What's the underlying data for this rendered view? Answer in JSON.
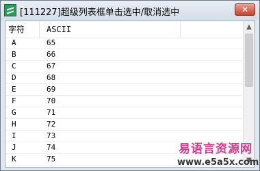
{
  "window": {
    "title": "[111227]超级列表框单击选中/取消选中",
    "close_glyph": "✕"
  },
  "list": {
    "columns": [
      "字符",
      "ASCII"
    ],
    "rows": [
      {
        "char": "A",
        "ascii": "65"
      },
      {
        "char": "B",
        "ascii": "66"
      },
      {
        "char": "C",
        "ascii": "67"
      },
      {
        "char": "D",
        "ascii": "68"
      },
      {
        "char": "E",
        "ascii": "69"
      },
      {
        "char": "F",
        "ascii": "70"
      },
      {
        "char": "G",
        "ascii": "71"
      },
      {
        "char": "H",
        "ascii": "72"
      },
      {
        "char": "I",
        "ascii": "73"
      },
      {
        "char": "J",
        "ascii": "74"
      },
      {
        "char": "K",
        "ascii": "75"
      }
    ]
  },
  "scrollbar": {
    "up_glyph": "▲",
    "down_glyph": "▼"
  },
  "watermark": {
    "line1": "易语言资源网",
    "line2": "www.e5a5x.com"
  },
  "icons": {
    "app": "app-icon",
    "close": "close-icon",
    "scroll_up": "chevron-up-icon",
    "scroll_down": "chevron-down-icon"
  }
}
